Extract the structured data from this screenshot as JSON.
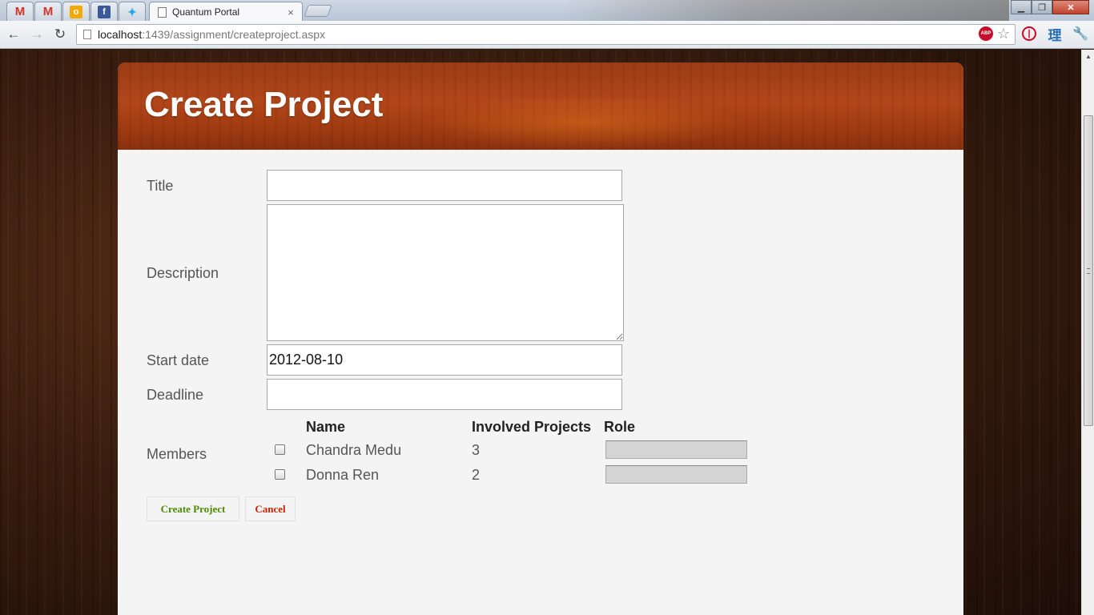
{
  "browser": {
    "tab_title": "Quantum Portal",
    "tab_close": "×",
    "url_host": "localhost",
    "url_rest": ":1439/assignment/createproject.aspx",
    "pinned_icons": [
      "gmail-icon",
      "gmail-icon",
      "orange-app-icon",
      "facebook-icon",
      "twitter-icon"
    ],
    "extension_icons": [
      "adblock-icon",
      "bookmark-star-icon",
      "power-icon",
      "kanji-icon",
      "wrench-icon"
    ],
    "abp_label": "ABP",
    "kanji": "理"
  },
  "page": {
    "title": "Create Project",
    "form": {
      "title_label": "Title",
      "title_value": "",
      "description_label": "Description",
      "description_value": "",
      "start_label": "Start date",
      "start_value": "2012-08-10",
      "deadline_label": "Deadline",
      "deadline_value": "",
      "members_label": "Members"
    },
    "members_table": {
      "headers": [
        "Name",
        "Involved Projects",
        "Role"
      ],
      "rows": [
        {
          "name": "Chandra Medu",
          "involved": "3",
          "role": "",
          "checked": false
        },
        {
          "name": "Donna Ren",
          "involved": "2",
          "role": "",
          "checked": false
        }
      ]
    },
    "buttons": {
      "create": "Create Project",
      "cancel": "Cancel"
    }
  }
}
